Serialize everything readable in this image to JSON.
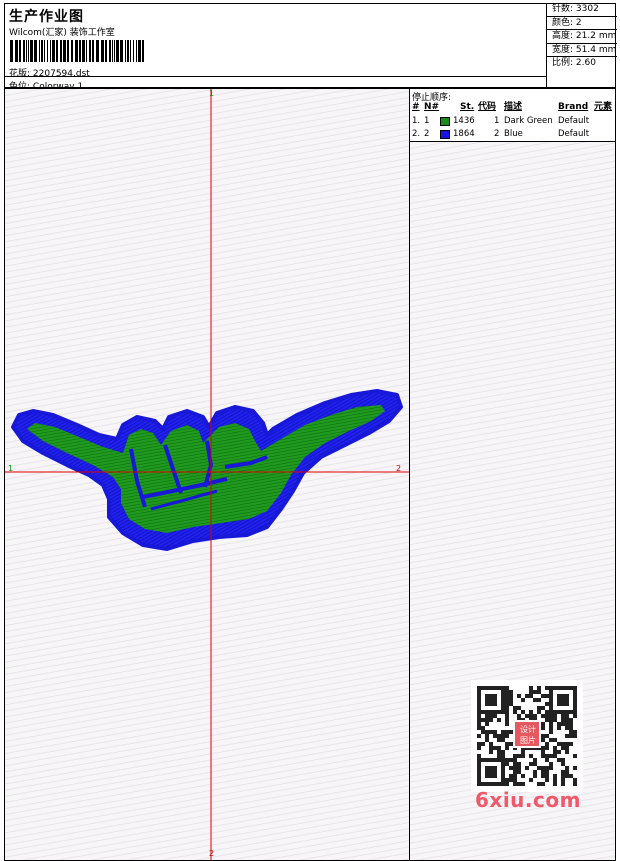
{
  "header": {
    "title": "生产作业图",
    "company": "Wilcom(汇家) 装饰工作室",
    "design_label": "花版:",
    "design_value": "2207594.dst",
    "colorway_label": "色位:",
    "colorway_value": "Colorway 1"
  },
  "stats": [
    {
      "label": "针数:",
      "value": "3302"
    },
    {
      "label": "颜色:",
      "value": "2"
    },
    {
      "label": "高度:",
      "value": "21.2 mm"
    },
    {
      "label": "宽度:",
      "value": "51.4 mm"
    },
    {
      "label": "比例:",
      "value": "2.60"
    }
  ],
  "stop_sequence": {
    "title": "停止顺序:",
    "columns": [
      "#",
      "N#",
      "St.",
      "代码",
      "描述",
      "Brand",
      "元素"
    ],
    "rows": [
      {
        "index": "1.",
        "needle": "1",
        "color": "#1a8a1a",
        "stitches": "1436",
        "code": "1",
        "description": "Dark Green",
        "brand": "Default"
      },
      {
        "index": "2.",
        "needle": "2",
        "color": "#1414e6",
        "stitches": "1864",
        "code": "2",
        "description": "Blue",
        "brand": "Default"
      }
    ]
  },
  "axes": {
    "top_label": "1",
    "bottom_label": "2",
    "left_label": "1",
    "right_label": "2"
  },
  "watermark": {
    "text": "6xiu.com",
    "stamp": "设计图片"
  }
}
